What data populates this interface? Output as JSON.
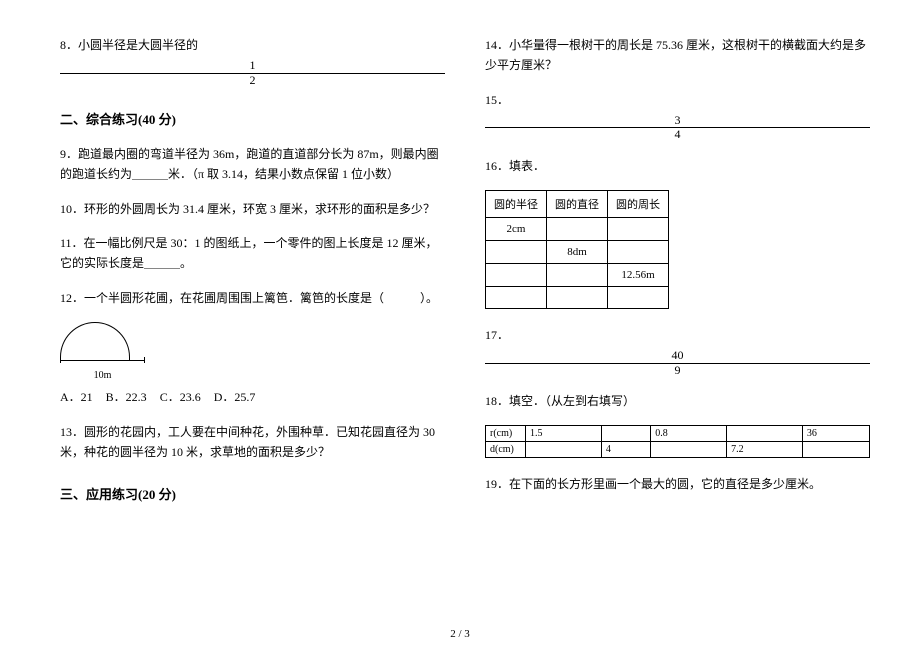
{
  "left": {
    "q8": "8．小圆半径是大圆半径的",
    "q8_frac_num": "1",
    "q8_frac_den": "2",
    "section2": "二、综合练习(40 分)",
    "q9": "9．跑道最内圈的弯道半径为 36m，跑道的直道部分长为 87m，则最内圈的跑道长约为＿＿＿米．（π 取 3.14，结果小数点保留 1 位小数）",
    "q10": "10．环形的外圆周长为 31.4 厘米，环宽 3 厘米，求环形的面积是多少？",
    "q11": "11．在一幅比例尺是 30：1 的图纸上，一个零件的图上长度是 12 厘米，它的实际长度是＿＿＿。",
    "q12": "12．一个半圆形花圃，在花圃周围围上篱笆．篱笆的长度是（　　　）。",
    "dim_label": "10m",
    "optA": "A．21",
    "optB": "B．22.3",
    "optC": "C．23.6",
    "optD": "D．25.7",
    "q13": "13．圆形的花园内，工人要在中间种花，外围种草．已知花园直径为 30 米，种花的圆半径为 10 米，求草地的面积是多少？",
    "section3": "三、应用练习(20 分)"
  },
  "right": {
    "q14": "14．小华量得一根树干的周长是 75.36 厘米，这根树干的横截面大约是多少平方厘米？",
    "q15": "15．",
    "q15_frac_num": "3",
    "q15_frac_den": "4",
    "q16": "16．填表．",
    "t1_h1": "圆的半径",
    "t1_h2": "圆的直径",
    "t1_h3": "圆的周长",
    "t1_r1c1": "2cm",
    "t1_r2c2": "8dm",
    "t1_r3c3": "12.56m",
    "q17": "17．",
    "q17_frac_num": "40",
    "q17_frac_den": "9",
    "q18": "18．填空．（从左到右填写）",
    "t2_r_label": "r(cm)",
    "t2_d_label": "d(cm)",
    "t2_r1": "1.5",
    "t2_r3": "0.8",
    "t2_r5": "36",
    "t2_d2": "4",
    "t2_d4": "7.2",
    "q19": "19．在下面的长方形里画一个最大的圆，它的直径是多少厘米。"
  },
  "pagenum": "2 / 3"
}
